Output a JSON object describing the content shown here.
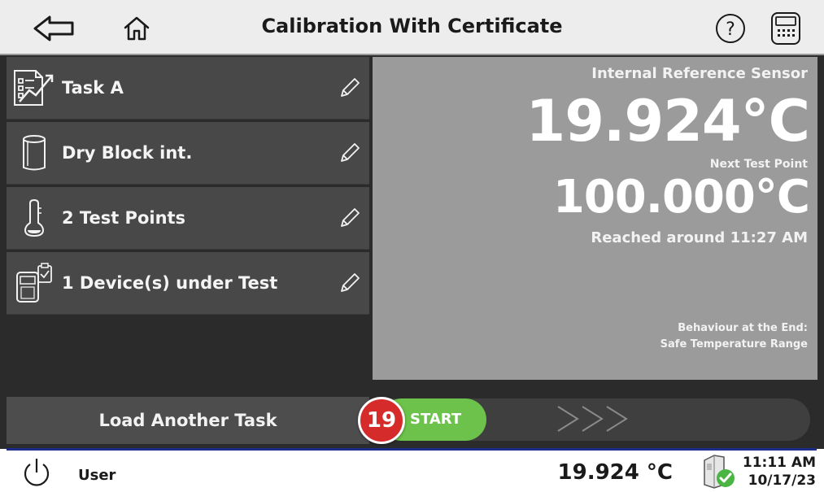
{
  "header": {
    "title": "Calibration With Certificate",
    "icons": [
      "back-arrow-icon",
      "home-icon",
      "help-icon",
      "calibrator-device-icon"
    ]
  },
  "task_list": [
    {
      "label": "Task A",
      "icon": "task-chart-icon"
    },
    {
      "label": "Dry Block int.",
      "icon": "dry-block-icon"
    },
    {
      "label": "2 Test Points",
      "icon": "thermometer-icon"
    },
    {
      "label": "1 Device(s) under Test",
      "icon": "device-clipboard-icon"
    }
  ],
  "info_panel": {
    "sensor_label": "Internal Reference Sensor",
    "sensor_temp": "19.924°C",
    "next_label": "Next Test Point",
    "next_temp": "100.000°C",
    "reached": "Reached around 11:27 AM",
    "behaviour_title": "Behaviour at the End:",
    "behaviour_value": "Safe Temperature Range"
  },
  "actions": {
    "load_task": "Load Another Task",
    "start": "START",
    "arrows": ">>>",
    "badge": "19"
  },
  "status_bar": {
    "user": "User",
    "temperature": "19.924 °C",
    "time": "11:11 AM",
    "date": "10/17/23"
  },
  "colors": {
    "header_bg": "#ededed",
    "main_bg": "#2b2b2b",
    "panel_bg": "#9b9b9b",
    "start_green": "#6cc24a",
    "badge_red": "#d52b2b",
    "accent_blue": "#1c2e8a"
  }
}
